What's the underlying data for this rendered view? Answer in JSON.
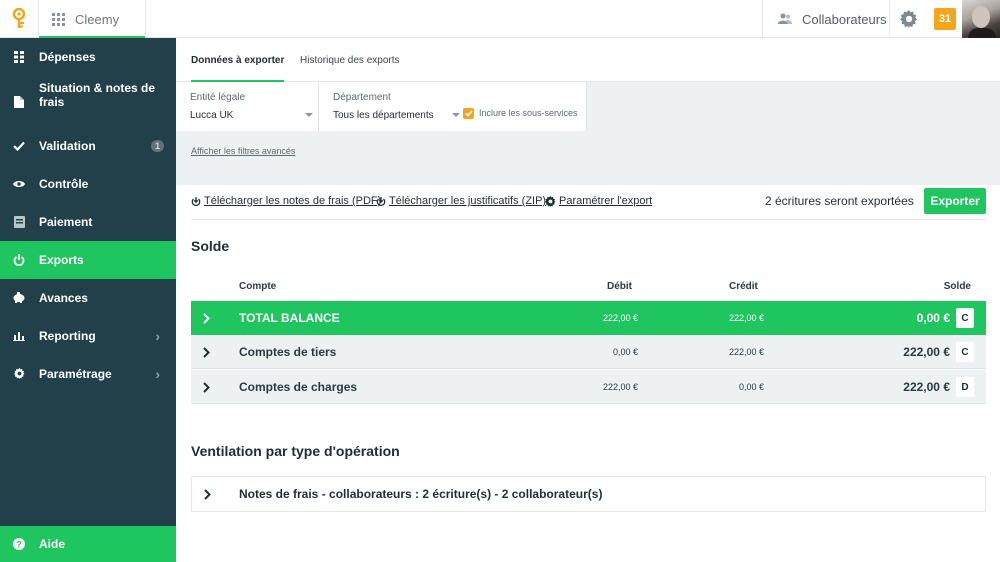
{
  "app": {
    "name": "Cleemy",
    "logo_icon": "lucca-logo-icon",
    "apps_icon": "grid-icon"
  },
  "header": {
    "collaborators_label": "Collaborateurs",
    "collaborators_icon": "people-icon",
    "settings_icon": "gear-icon",
    "calendar_day": "31",
    "calendar_color": "#f3a51b"
  },
  "sidebar": {
    "items": [
      {
        "label": "Dépenses",
        "icon": "grid-icon"
      },
      {
        "label": "Situation & notes de frais",
        "icon": "document-icon"
      },
      {
        "label": "Validation",
        "icon": "check-icon",
        "badge": "1"
      },
      {
        "label": "Contrôle",
        "icon": "eye-icon"
      },
      {
        "label": "Paiement",
        "icon": "payment-icon"
      },
      {
        "label": "Exports",
        "icon": "power-icon",
        "active": true
      },
      {
        "label": "Avances",
        "icon": "piggy-bank-icon"
      },
      {
        "label": "Reporting",
        "icon": "bar-chart-icon",
        "has_submenu": true
      },
      {
        "label": "Paramétrage",
        "icon": "gear-icon",
        "has_submenu": true
      }
    ],
    "help_label": "Aide",
    "help_icon": "question-icon"
  },
  "tabs": [
    {
      "label": "Données à exporter",
      "active": true
    },
    {
      "label": "Historique des exports",
      "active": false
    }
  ],
  "filters": {
    "entity_label": "Entité légale",
    "entity_value": "Lucca UK",
    "department_label": "Département",
    "department_value": "Tous les départements",
    "include_subservices_label": "Inclure les sous-services",
    "include_subservices_checked": true,
    "advanced_filters_link": "Afficher les filtres avancés"
  },
  "actions": {
    "download_pdf": "Télécharger les notes de frais (PDF)",
    "download_zip": "Télécharger les justificatifs (ZIP)",
    "configure_export": "Paramétrer l'export",
    "entries_count_text": "2 écritures seront exportées",
    "export_button": "Exporter"
  },
  "balance": {
    "title": "Solde",
    "columns": {
      "account": "Compte",
      "debit": "Débit",
      "credit": "Crédit",
      "balance": "Solde"
    },
    "rows": [
      {
        "name": "TOTAL BALANCE",
        "debit": "222,00 €",
        "credit": "222,00 €",
        "balance": "0,00 €",
        "direction": "C",
        "style": "total"
      },
      {
        "name": "Comptes de tiers",
        "debit": "0,00 €",
        "credit": "222,00 €",
        "balance": "222,00 €",
        "direction": "C",
        "style": "grey"
      },
      {
        "name": "Comptes de charges",
        "debit": "222,00 €",
        "credit": "0,00 €",
        "balance": "222,00 €",
        "direction": "D",
        "style": "grey"
      }
    ]
  },
  "breakdown": {
    "title": "Ventilation par type d'opération",
    "rows": [
      {
        "text": "Notes de frais - collaborateurs : 2 écriture(s) - 2 collaborateur(s)"
      }
    ]
  },
  "colors": {
    "accent_green": "#1fc55f",
    "sidebar_bg": "#22404a",
    "warning_orange": "#f3a51b"
  }
}
